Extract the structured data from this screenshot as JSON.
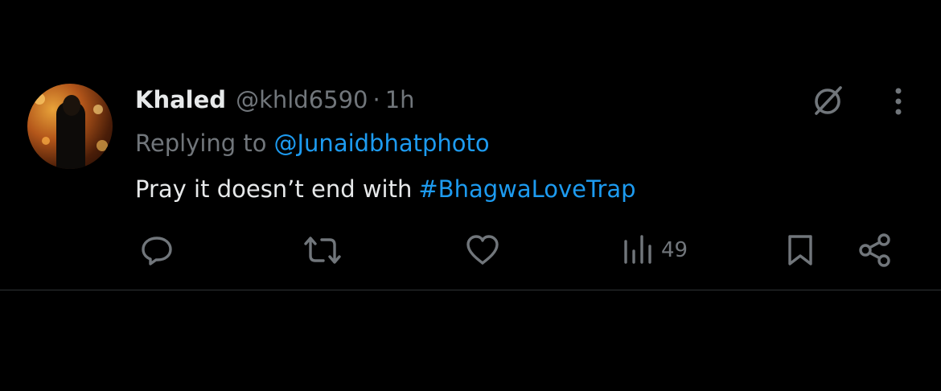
{
  "tweet": {
    "author_name": "Khaled",
    "author_handle": "@khld6590",
    "separator": "·",
    "time": "1h",
    "reply_prefix": "Replying to",
    "reply_to": "@Junaidbhatphoto",
    "body_text": "Pray it doesn’t end with",
    "hashtag": "#BhagwaLoveTrap"
  },
  "actions": {
    "reply_icon": "speech-bubble-icon",
    "repost_icon": "repost-arrows-icon",
    "like_icon": "heart-icon",
    "views_icon": "bar-chart-icon",
    "views_count": "49",
    "bookmark_icon": "bookmark-icon",
    "share_icon": "share-nodes-icon"
  },
  "top_icons": {
    "grok": "grok-slash-circle-icon",
    "more": "vertical-ellipsis-icon"
  },
  "colors": {
    "background": "#000000",
    "text_primary": "#e7e9ea",
    "text_secondary": "#71767b",
    "accent": "#1d9bf0",
    "divider": "#2f3336"
  }
}
